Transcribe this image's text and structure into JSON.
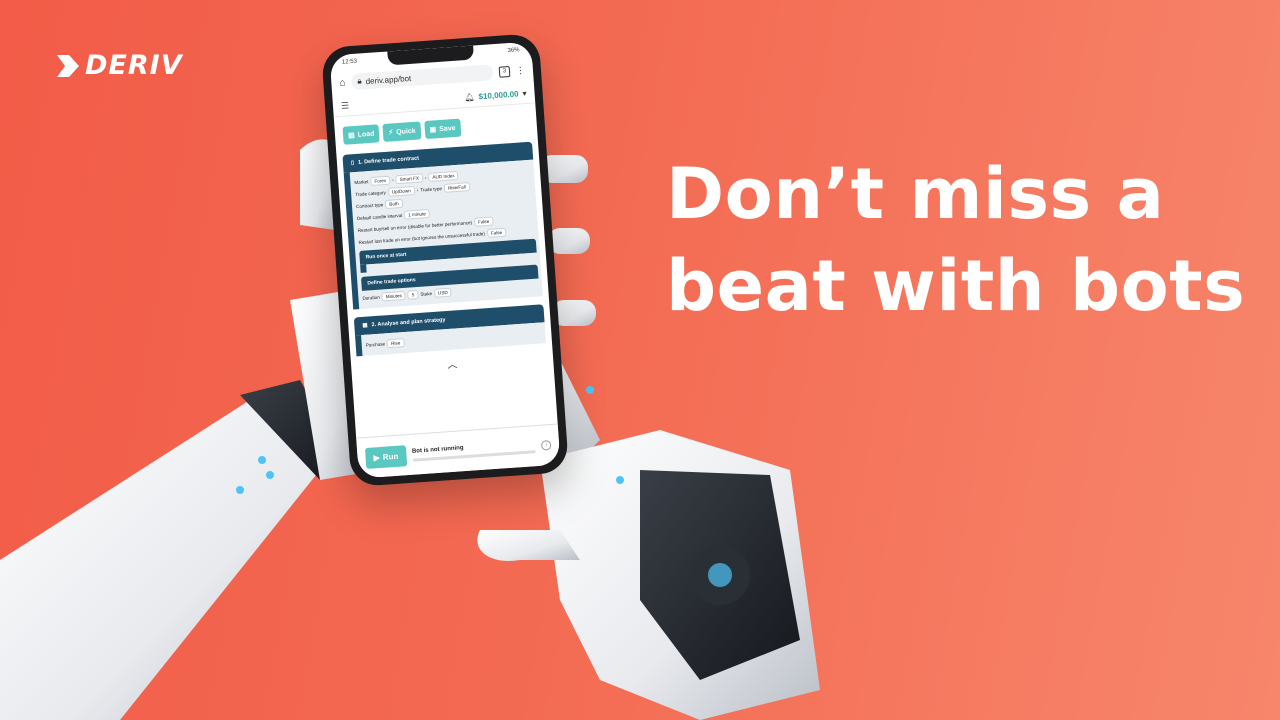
{
  "brand": {
    "name": "DERIV"
  },
  "headline": {
    "line1": "Don’t miss a",
    "line2": "beat with bots"
  },
  "colors": {
    "background": "#f25c48",
    "accent": "#5ac8c0",
    "block": "#1f4e6b"
  },
  "phone": {
    "status": {
      "time": "12:53",
      "battery": "36%"
    },
    "browser": {
      "url": "deriv.app/bot",
      "tab_count": "3"
    },
    "balance": "$10,000.00",
    "toolbar": {
      "load": "Load",
      "quick": "Quick",
      "save": "Save"
    },
    "block1": {
      "title": "1. Define trade contract",
      "market_label": "Market",
      "market": "Forex",
      "submarket": "Smart FX",
      "symbol": "AUD Index",
      "category_label": "Trade category",
      "category": "Up/Down",
      "type_label": "Trade type",
      "type": "Rise/Fall",
      "contract_type_label": "Contract type",
      "contract_type": "Both",
      "candle_label": "Default candle interval",
      "candle": "1 minute",
      "restart_buy_label": "Restart buy/sell on error (disable for better performance)",
      "restart_buy": "False",
      "restart_last_label": "Restart last trade on error (bot ignores the unsuccessful trade)",
      "restart_last": "False",
      "run_once": "Run once at start",
      "define_options": "Define trade options",
      "duration_label": "Duration",
      "duration_unit": "Minutes",
      "duration_value": "5",
      "stake_label": "Stake",
      "currency": "USD"
    },
    "block2": {
      "title": "2. Analyse and plan strategy",
      "purchase_label": "Purchase",
      "purchase": "Rise"
    },
    "run": {
      "button": "Run",
      "status": "Bot is not running"
    }
  }
}
